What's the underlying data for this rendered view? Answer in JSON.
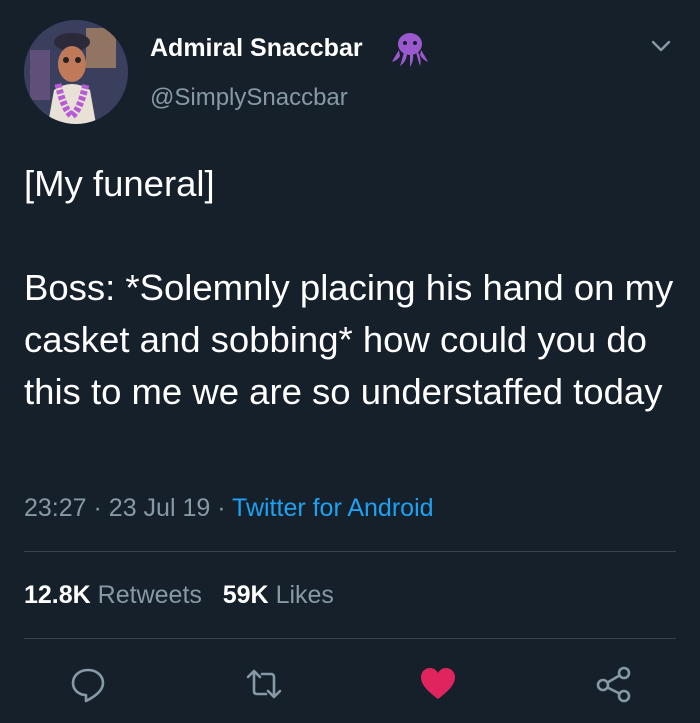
{
  "user": {
    "display_name": "Admiral Snaccbar",
    "handle": "@SimplySnaccbar",
    "badge_icon": "octopus-emoji",
    "badge_color": "#9b59d0"
  },
  "tweet": {
    "line1": "[My funeral]",
    "body": "Boss: *Solemnly placing his hand on my casket and sobbing* how could you do this to me we are so understaffed today"
  },
  "meta": {
    "time": "23:27",
    "separator": "·",
    "date": "23 Jul 19",
    "source": "Twitter for Android"
  },
  "stats": {
    "retweets_count": "12.8K",
    "retweets_label": "Retweets",
    "likes_count": "59K",
    "likes_label": "Likes"
  },
  "actions": {
    "reply_icon": "reply-icon",
    "retweet_icon": "retweet-icon",
    "like_icon": "heart-icon",
    "share_icon": "share-icon",
    "like_color": "#e0245e"
  },
  "colors": {
    "background": "#15202b",
    "secondary_text": "#8899a6",
    "link": "#1da1f2",
    "divider": "#38444d"
  }
}
